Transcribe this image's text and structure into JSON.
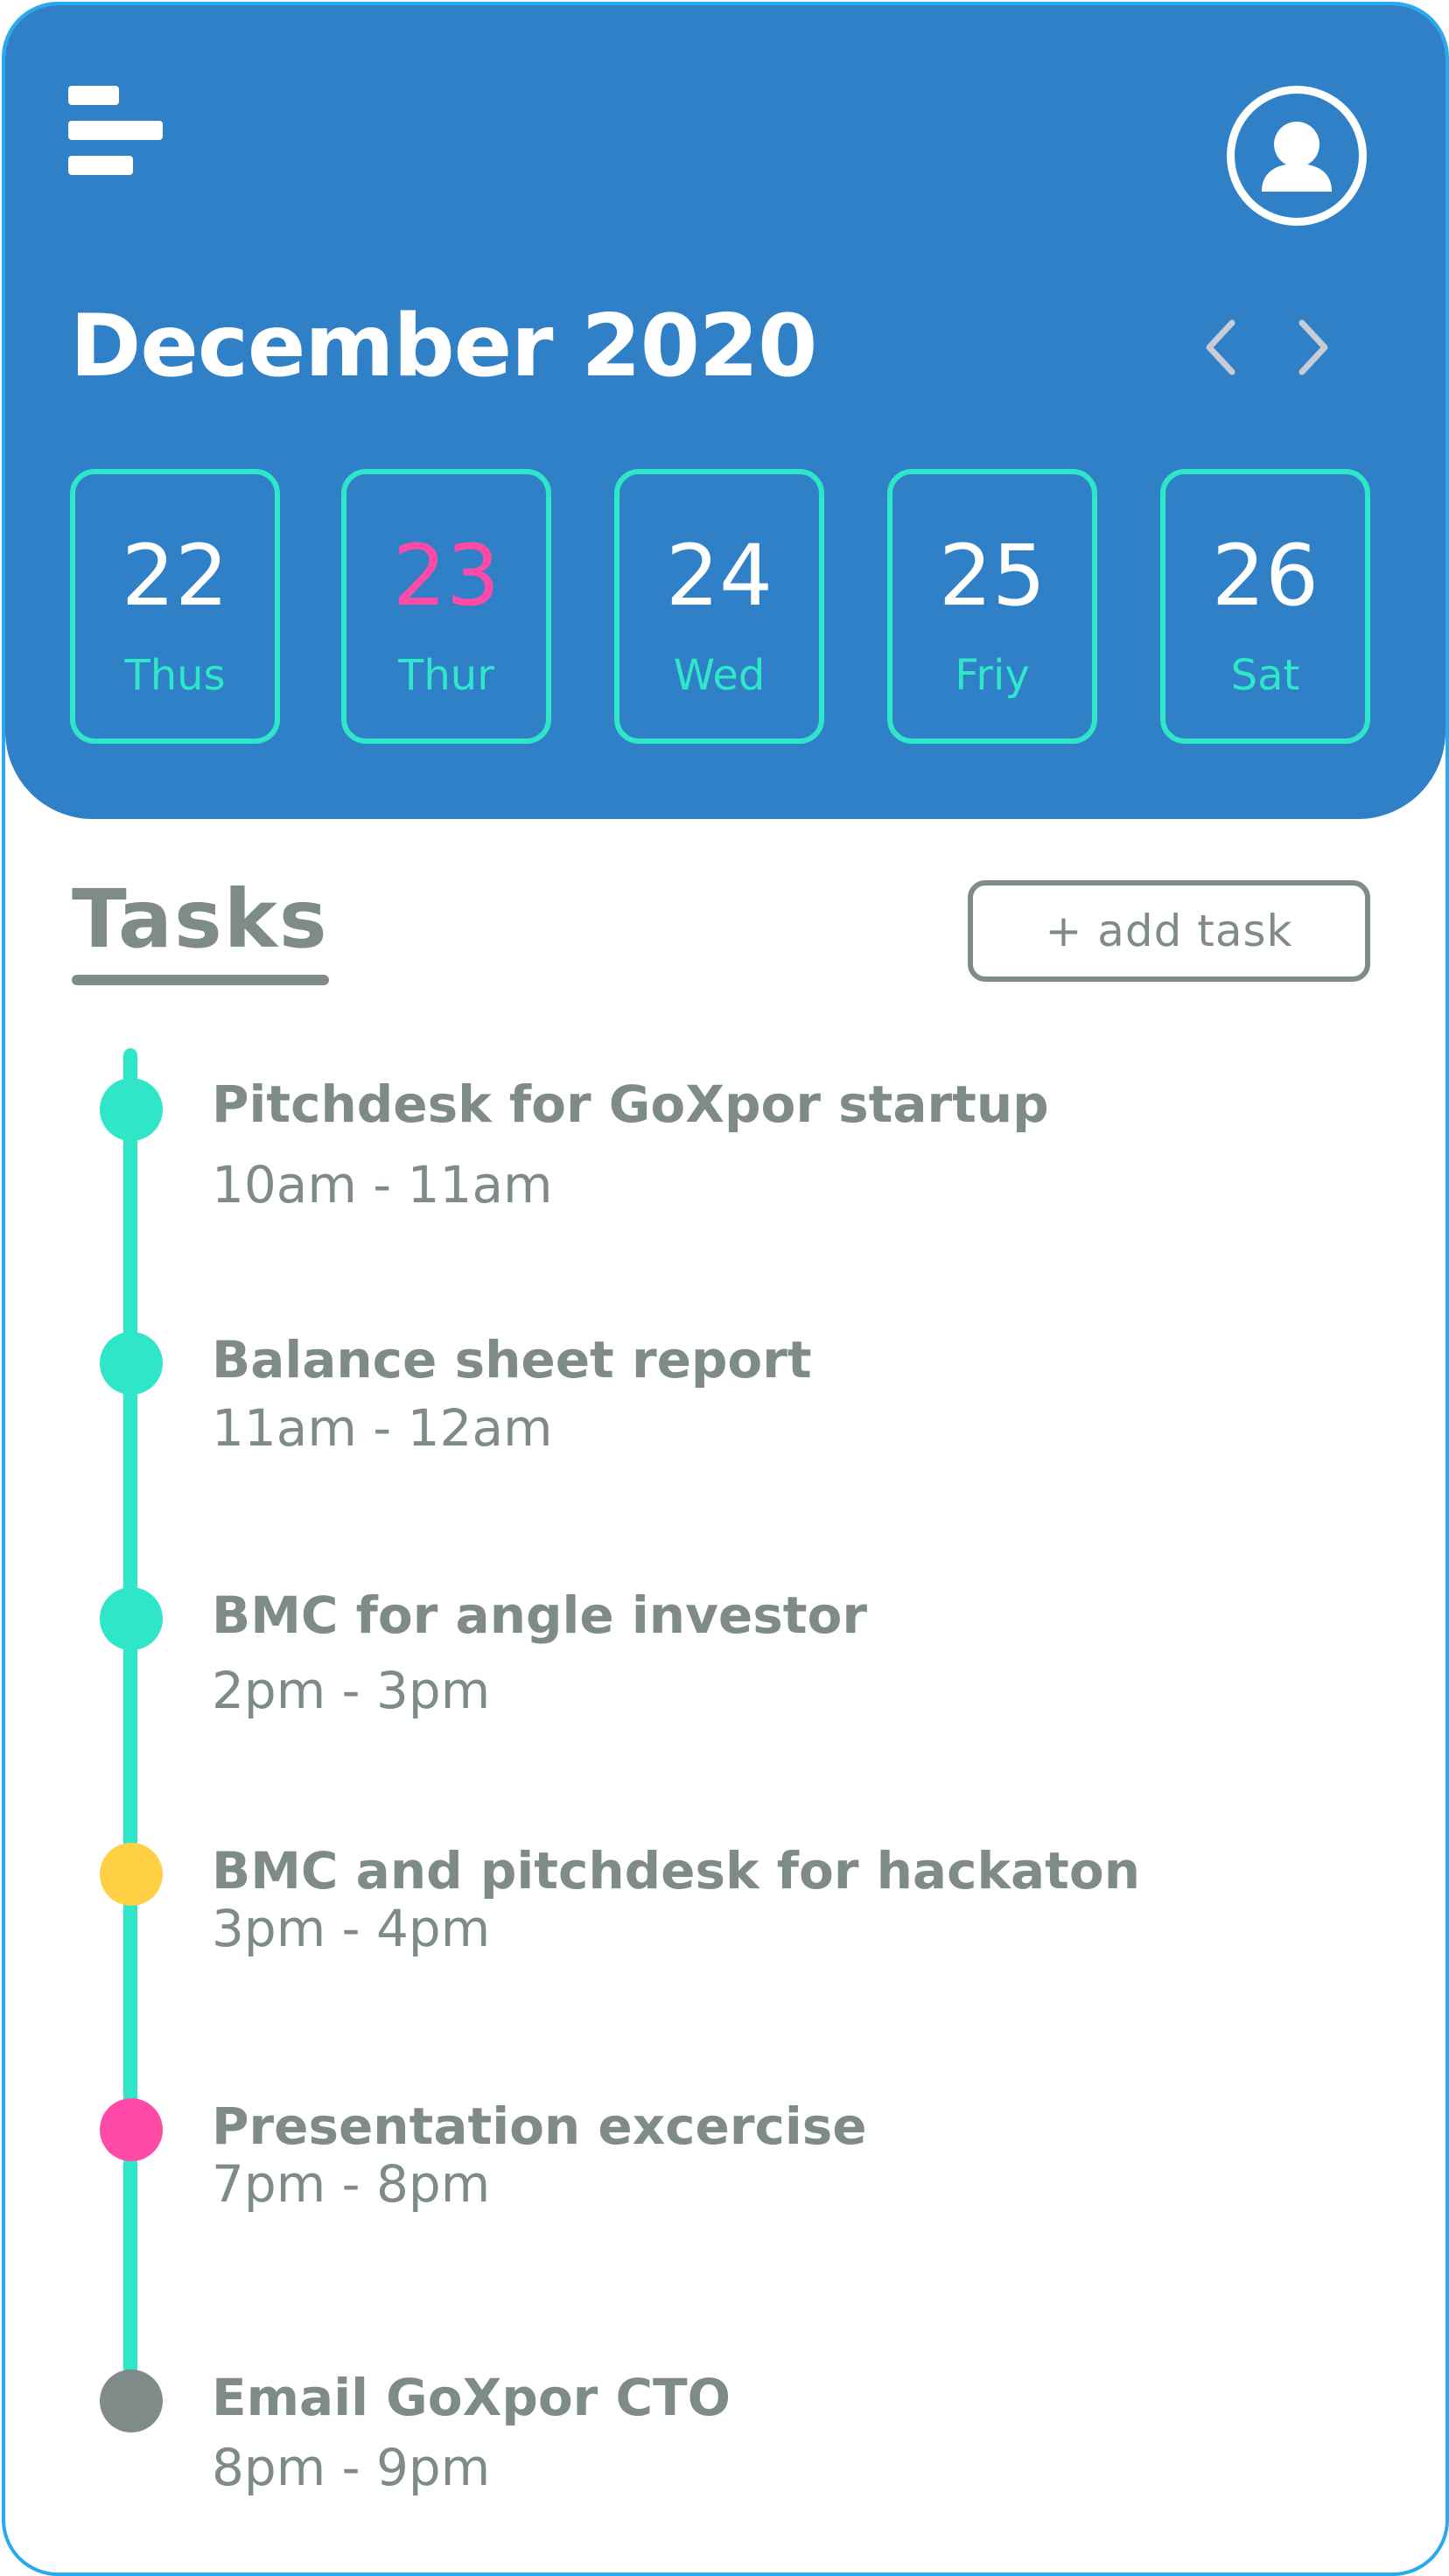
{
  "header": {
    "month_title": "December 2020",
    "colors": {
      "background": "#3080c8",
      "accent": "#2fe6c8",
      "today": "#ff4aa8"
    },
    "icons": {
      "menu": "menu-icon",
      "profile": "user-avatar-icon",
      "prev": "chevron-left-icon",
      "next": "chevron-right-icon"
    }
  },
  "days": [
    {
      "number": "22",
      "label": "Thus",
      "selected": false
    },
    {
      "number": "23",
      "label": "Thur",
      "selected": true
    },
    {
      "number": "24",
      "label": "Wed",
      "selected": false
    },
    {
      "number": "25",
      "label": "Friy",
      "selected": false
    },
    {
      "number": "26",
      "label": "Sat",
      "selected": false
    }
  ],
  "tasks_section": {
    "title": "Tasks",
    "add_task_label": "+ add task"
  },
  "tasks": [
    {
      "title": "Pitchdesk for GoXpor startup",
      "time": "10am - 11am",
      "color": "#2fe6c8"
    },
    {
      "title": "Balance sheet report",
      "time": "11am - 12am",
      "color": "#2fe6c8"
    },
    {
      "title": "BMC for angle investor",
      "time": "2pm - 3pm",
      "color": "#2fe6c8"
    },
    {
      "title": "BMC and pitchdesk for hackaton",
      "time": "3pm - 4pm",
      "color": "#ffd044"
    },
    {
      "title": "Presentation excercise",
      "time": "7pm - 8pm",
      "color": "#ff4aa8"
    },
    {
      "title": "Email GoXpor CTO",
      "time": "8pm - 9pm",
      "color": "#7e8b88"
    }
  ]
}
